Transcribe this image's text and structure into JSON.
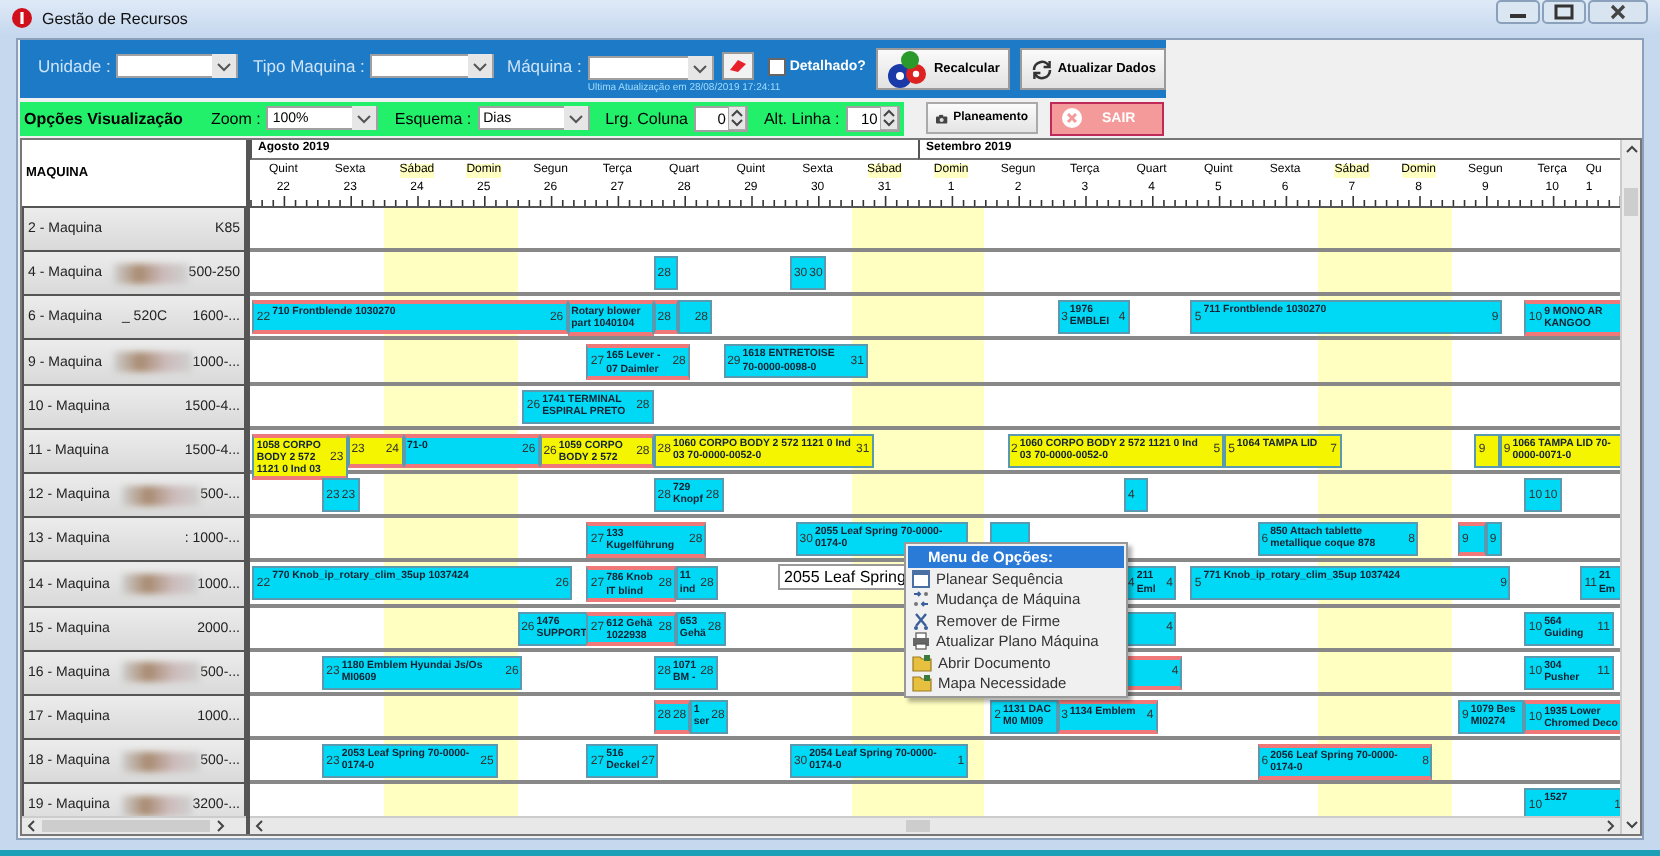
{
  "window": {
    "title": "Gestão de Recursos"
  },
  "filters": [
    {
      "label": "Unidade :"
    },
    {
      "label": "Tipo Maquina :"
    },
    {
      "label": "Máquina :"
    }
  ],
  "detail_checkbox": {
    "label": "Detalhado?",
    "checked": false
  },
  "last_update": "Ultima Atualização em 28/08/2019 17:24:11",
  "action_buttons": [
    {
      "label": "Recalcular"
    },
    {
      "label": "Atualizar Dados"
    }
  ],
  "view_options": {
    "title": "Opções Visualização",
    "fields": [
      {
        "label": "Zoom :",
        "value": "100%",
        "kind": "dropdown"
      },
      {
        "label": "Esquema :",
        "value": "Dias",
        "kind": "dropdown"
      },
      {
        "label": "Lrg. Coluna",
        "value": "0",
        "kind": "spinner"
      },
      {
        "label": "Alt. Linha :",
        "value": "10",
        "kind": "spinner"
      }
    ]
  },
  "planeamento_button": {
    "label": "Planeamento"
  },
  "exit_button": {
    "label": "SAIR"
  },
  "gantt": {
    "column_header": "MAQUINA",
    "days": [
      {
        "weekday": "Quint",
        "number": "22",
        "weekend": false,
        "month": "Agosto 2019"
      },
      {
        "weekday": "Sexta",
        "number": "23",
        "weekend": false
      },
      {
        "weekday": "Sábad",
        "number": "24",
        "weekend": true
      },
      {
        "weekday": "Domin",
        "number": "25",
        "weekend": true
      },
      {
        "weekday": "Segun",
        "number": "26",
        "weekend": false
      },
      {
        "weekday": "Terça",
        "number": "27",
        "weekend": false
      },
      {
        "weekday": "Quart",
        "number": "28",
        "weekend": false
      },
      {
        "weekday": "Quint",
        "number": "29",
        "weekend": false
      },
      {
        "weekday": "Sexta",
        "number": "30",
        "weekend": false
      },
      {
        "weekday": "Sábad",
        "number": "31",
        "weekend": true
      },
      {
        "weekday": "Domin",
        "number": "1",
        "weekend": true,
        "month": "Setembro 2019"
      },
      {
        "weekday": "Segun",
        "number": "2",
        "weekend": false
      },
      {
        "weekday": "Terça",
        "number": "3",
        "weekend": false
      },
      {
        "weekday": "Quart",
        "number": "4",
        "weekend": false
      },
      {
        "weekday": "Quint",
        "number": "5",
        "weekend": false
      },
      {
        "weekday": "Sexta",
        "number": "6",
        "weekend": false
      },
      {
        "weekday": "Sábad",
        "number": "7",
        "weekend": true
      },
      {
        "weekday": "Domin",
        "number": "8",
        "weekend": true
      },
      {
        "weekday": "Segun",
        "number": "9",
        "weekend": false
      },
      {
        "weekday": "Terça",
        "number": "10",
        "weekend": false
      },
      {
        "weekday": "Qu",
        "number": "1",
        "weekend": false
      }
    ],
    "rows": [
      {
        "label": "2 - Maquina",
        "spec": "K85",
        "redacted": false,
        "bars": []
      },
      {
        "label": "4 - Maquina",
        "spec": "500-250",
        "redacted": true,
        "bars": [
          {
            "start_label": "28",
            "color": "#00d9f5",
            "flagged": false
          },
          {
            "start_label": "30",
            "end_label": "30",
            "color": "#00d9f5",
            "flagged": false
          }
        ]
      },
      {
        "label": "6 - Maquina",
        "model": "_ 520C",
        "spec": "1600-...",
        "redacted": false,
        "bars": [
          {
            "start_label": "22",
            "title": "710 Frontblende 1030270",
            "end_label": "26",
            "color": "#00d9f5",
            "flagged": true
          },
          {
            "title": "Rotary blower part 1040104",
            "color": "#00d9f5",
            "flagged": true
          },
          {
            "start_label": "28",
            "color": "#00d9f5",
            "flagged": true
          },
          {
            "end_label": "28",
            "color": "#00d9f5",
            "flagged": false
          },
          {
            "start_label": "3",
            "title": "1976 EMBLEI",
            "end_label": "4",
            "color": "#00d9f5",
            "flagged": false
          },
          {
            "start_label": "5",
            "title": "711 Frontblende 1030270",
            "end_label": "9",
            "color": "#00d9f5",
            "flagged": false
          },
          {
            "start_label": "10",
            "title": "9 MONO AR KANGOO",
            "color": "#00d9f5",
            "flagged": true
          }
        ]
      },
      {
        "label": "9 - Maquina",
        "spec": "1000-...",
        "redacted": true,
        "bars": [
          {
            "start_label": "27",
            "title": "165 Lever - 07 Daimler",
            "end_label": "28",
            "color": "#00d9f5",
            "flagged": true
          },
          {
            "start_label": "29",
            "title": "1618 ENTRETOISE 70-0000-0098-0",
            "end_label": "31",
            "color": "#00d9f5",
            "flagged": false
          }
        ]
      },
      {
        "label": "10 - Maquina",
        "spec": "1500-4...",
        "redacted": false,
        "bars": [
          {
            "start_label": "26",
            "title": "1741 TERMINAL ESPIRAL PRETO",
            "end_label": "28",
            "color": "#00d9f5",
            "flagged": false
          }
        ]
      },
      {
        "label": "11 - Maquina",
        "spec": "1500-4...",
        "redacted": false,
        "bars": [
          {
            "title": "1058 CORPO BODY 2 572 1121 0 Ind 03",
            "end_label": "23",
            "color": "#f5f500",
            "flagged": true
          },
          {
            "start_label": "23",
            "end_label": "24",
            "color": "#f5f500",
            "flagged": true
          },
          {
            "title": "71-0",
            "end_label": "26",
            "color": "#00d9f5",
            "flagged": true
          },
          {
            "start_label": "26",
            "title": "1059 CORPO BODY 2 572",
            "end_label": "28",
            "color": "#f5f500",
            "flagged": true
          },
          {
            "start_label": "28",
            "title": "1060 CORPO BODY 2 572 1121 0 Ind 03 70-0000-0052-0",
            "end_label": "31",
            "color": "#f5f500",
            "flagged": false
          },
          {
            "start_label": "2",
            "title": "1060 CORPO BODY 2 572 1121 0 Ind 03 70-0000-0052-0",
            "end_label": "5",
            "color": "#f5f500",
            "flagged": false
          },
          {
            "start_label": "5",
            "title": "1064 TAMPA LID",
            "end_label": "7",
            "color": "#f5f500",
            "flagged": false
          },
          {
            "start_label": "9",
            "color": "#f5f500",
            "flagged": false
          },
          {
            "start_label": "9",
            "title": "1066 TAMPA LID 70-0000-0071-0",
            "color": "#f5f500",
            "flagged": false
          }
        ]
      },
      {
        "label": "12 - Maquina",
        "spec": "500-...",
        "redacted": true,
        "bars": [
          {
            "start_label": "23",
            "end_label": "23",
            "color": "#00d9f5",
            "flagged": false
          },
          {
            "start_label": "28",
            "title": "729 Knopf",
            "end_label": "28",
            "color": "#00d9f5",
            "flagged": false
          },
          {
            "start_label": "4",
            "color": "#00d9f5",
            "flagged": false
          },
          {
            "start_label": "10",
            "end_label": "10",
            "color": "#00d9f5",
            "flagged": false
          }
        ]
      },
      {
        "label": "13 - Maquina",
        "spec": ": 1000-...",
        "redacted": false,
        "bars": [
          {
            "start_label": "27",
            "title": "133 Kugelführung",
            "end_label": "28",
            "color": "#00d9f5",
            "flagged": true
          },
          {
            "start_label": "30",
            "title": "2055 Leaf Spring 70-0000-0174-0",
            "color": "#00d9f5",
            "flagged": false
          },
          {
            "color": "#00d9f5",
            "flagged": false
          },
          {
            "start_label": "6",
            "title": "850 Attach tablette metallique coque 878",
            "end_label": "8",
            "color": "#00d9f5",
            "flagged": false
          },
          {
            "start_label": "9",
            "color": "#00d9f5",
            "flagged": true
          },
          {
            "start_label": "9",
            "color": "#00d9f5",
            "flagged": false
          }
        ]
      },
      {
        "label": "14 - Maquina",
        "spec": "1000...",
        "redacted": true,
        "bars": [
          {
            "start_label": "22",
            "title": "770 Knob_ip_rotary_clim_35up 1037424",
            "end_label": "26",
            "color": "#00d9f5",
            "flagged": false
          },
          {
            "start_label": "27",
            "title": "786 Knob IT blind",
            "end_label": "28",
            "color": "#00d9f5",
            "flagged": true
          },
          {
            "title": "11 ind",
            "end_label": "28",
            "color": "#00d9f5",
            "flagged": false
          },
          {
            "start_label": "4",
            "title": "211 Eml",
            "end_label": "4",
            "color": "#00d9f5",
            "flagged": false
          },
          {
            "start_label": "5",
            "title": "771 Knob_ip_rotary_clim_35up 1037424",
            "end_label": "9",
            "color": "#00d9f5",
            "flagged": false
          },
          {
            "start_label": "11",
            "title": "21 Em",
            "color": "#00d9f5",
            "flagged": false
          }
        ]
      },
      {
        "label": "15 - Maquina",
        "spec": "2000...",
        "redacted": false,
        "bars": [
          {
            "start_label": "26",
            "title": "1476 SUPPORT",
            "color": "#00d9f5",
            "flagged": false
          },
          {
            "start_label": "27",
            "title": "612 Gehä 1022938",
            "end_label": "28",
            "color": "#00d9f5",
            "flagged": true
          },
          {
            "title": "653 Gehä",
            "end_label": "28",
            "color": "#00d9f5",
            "flagged": false
          },
          {
            "end_label": "4",
            "color": "#00d9f5",
            "flagged": false
          },
          {
            "start_label": "10",
            "title": "564 Guiding",
            "end_label": "11",
            "color": "#00d9f5",
            "flagged": false
          }
        ]
      },
      {
        "label": "16 - Maquina",
        "spec": "500-...",
        "redacted": true,
        "bars": [
          {
            "start_label": "23",
            "title": "1180 Emblem Hyundai Js/Os MI0609",
            "end_label": "26",
            "color": "#00d9f5",
            "flagged": false
          },
          {
            "start_label": "28",
            "title": "1071 BM -",
            "end_label": "28",
            "color": "#00d9f5",
            "flagged": false
          },
          {
            "end_label": "4",
            "color": "#00d9f5",
            "flagged": true
          },
          {
            "start_label": "10",
            "title": "304 Pusher",
            "end_label": "11",
            "color": "#00d9f5",
            "flagged": false
          }
        ]
      },
      {
        "label": "17 - Maquina",
        "spec": "1000...",
        "redacted": false,
        "bars": [
          {
            "start_label": "28",
            "end_label": "28",
            "color": "#00d9f5",
            "flagged": true
          },
          {
            "title": "1 ser",
            "end_label": "28",
            "color": "#00d9f5",
            "flagged": false
          },
          {
            "start_label": "2",
            "title": "1131 DAC M0 MI09",
            "color": "#00d9f5",
            "flagged": false
          },
          {
            "start_label": "3",
            "title": "1134 Emblem",
            "end_label": "4",
            "color": "#00d9f5",
            "flagged": true
          },
          {
            "start_label": "9",
            "title": "1079 Bes MI0274",
            "color": "#00d9f5",
            "flagged": false
          },
          {
            "start_label": "10",
            "title": "1935 Lower Chromed Deco",
            "color": "#00d9f5",
            "flagged": true
          }
        ]
      },
      {
        "label": "18 - Maquina",
        "spec": "500-...",
        "redacted": true,
        "bars": [
          {
            "start_label": "23",
            "title": "2053 Leaf Spring 70-0000-0174-0",
            "end_label": "25",
            "color": "#00d9f5",
            "flagged": false
          },
          {
            "start_label": "27",
            "title": "516 Deckel",
            "end_label": "27",
            "color": "#00d9f5",
            "flagged": false
          },
          {
            "start_label": "30",
            "title": "2054 Leaf Spring 70-0000-0174-0",
            "end_label": "1",
            "color": "#00d9f5",
            "flagged": false
          },
          {
            "start_label": "6",
            "title": "2056 Leaf Spring 70-0000-0174-0",
            "end_label": "8",
            "color": "#00d9f5",
            "flagged": true
          }
        ]
      },
      {
        "label": "19 - Maquina",
        "spec": "3200-...",
        "redacted": true,
        "bars": [
          {
            "start_label": "10",
            "title": "1527",
            "end_label": "1",
            "color": "#00d9f5",
            "flagged": false
          }
        ]
      }
    ]
  },
  "tooltip": "2055 Leaf Spring",
  "context_menu": {
    "title": "Menu de Opções:",
    "items": [
      {
        "label": "Planear Sequência"
      },
      {
        "label": "Mudança de Máquina"
      },
      {
        "label": "Remover de Firme"
      },
      {
        "label": "Atualizar Plano Máquina"
      },
      {
        "label": "Abrir Documento"
      },
      {
        "label": "Mapa Necessidade"
      }
    ]
  }
}
